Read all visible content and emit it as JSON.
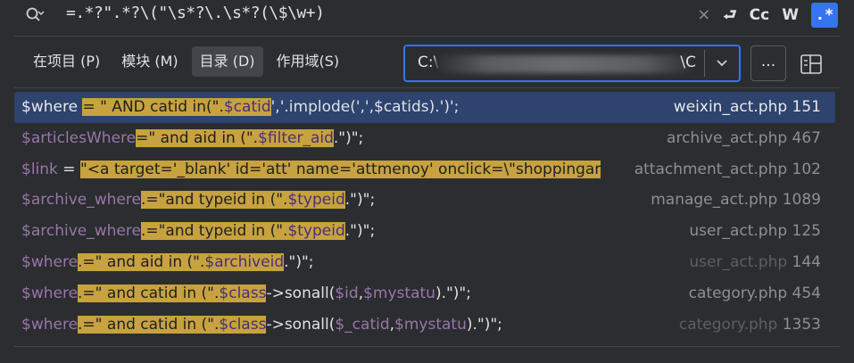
{
  "search": {
    "query": "=.*?\".*?\\(\"\\s*?\\.\\s*?(\\$\\w+)",
    "clear_label": "×",
    "newline_label": "⮐",
    "match_case_label": "Cc",
    "words_label": "W",
    "regex_label": ".*"
  },
  "scope": {
    "tabs": [
      {
        "label": "在项目 (P)"
      },
      {
        "label": "模块 (M)"
      },
      {
        "label": "目录 (D)"
      },
      {
        "label": "作用域(S)"
      }
    ],
    "active": 2
  },
  "directory": {
    "path_start": "C:\\",
    "path_end": "\\C",
    "browse_label": "..."
  },
  "results": [
    {
      "parts": [
        [
          "v",
          "$where"
        ],
        [
          "t",
          " "
        ],
        [
          "hl",
          "= \" AND catid in(\"."
        ],
        [
          "hv",
          "$catid"
        ],
        [
          "t",
          "','.implode(',',$catids).')';"
        ]
      ],
      "file": "weixin_act.php",
      "line": "151"
    },
    {
      "parts": [
        [
          "v",
          "$articlesWhere"
        ],
        [
          "hl",
          "=\" and aid in (\"."
        ],
        [
          "hv",
          "$filter_aid"
        ],
        [
          "t",
          ".\")\";"
        ]
      ],
      "file": "archive_act.php",
      "line": "467"
    },
    {
      "parts": [
        [
          "v",
          "$link"
        ],
        [
          "t",
          " = "
        ],
        [
          "hl",
          "\"<a target='_blank' id='att' name='attmenoy' onclick=\\\"shoppingar"
        ]
      ],
      "file": "attachment_act.php",
      "line": "102"
    },
    {
      "parts": [
        [
          "v",
          "$archive_where"
        ],
        [
          "hl",
          ".=\"and typeid in (\"."
        ],
        [
          "hv",
          "$typeid"
        ],
        [
          "t",
          ".\")\";"
        ]
      ],
      "file": "manage_act.php",
      "line": "1089"
    },
    {
      "parts": [
        [
          "v",
          "$archive_where"
        ],
        [
          "hl",
          ".=\"and typeid in (\"."
        ],
        [
          "hv",
          "$typeid"
        ],
        [
          "t",
          ".\")\";"
        ]
      ],
      "file": "user_act.php",
      "line": "125"
    },
    {
      "parts": [
        [
          "v",
          "$where"
        ],
        [
          "hl",
          ".=\" and aid in (\"."
        ],
        [
          "hv",
          "$archiveid"
        ],
        [
          "t",
          ".\")\";"
        ]
      ],
      "file": "user_act.php",
      "line": "144"
    },
    {
      "parts": [
        [
          "v",
          "$where"
        ],
        [
          "hl",
          ".=\" and catid in (\"."
        ],
        [
          "hv",
          "$class"
        ],
        [
          "t",
          "->sonall("
        ],
        [
          "v",
          "$id"
        ],
        [
          "t",
          ","
        ],
        [
          "v",
          "$mystatu"
        ],
        [
          "t",
          ").\")\";"
        ]
      ],
      "file": "category.php",
      "line": "454"
    },
    {
      "parts": [
        [
          "v",
          "$where"
        ],
        [
          "hl",
          ".=\" and catid in (\"."
        ],
        [
          "hv",
          "$class"
        ],
        [
          "t",
          "->sonall("
        ],
        [
          "v",
          "$_catid"
        ],
        [
          "t",
          ","
        ],
        [
          "v",
          "$mystatu"
        ],
        [
          "t",
          ").\")\";"
        ]
      ],
      "file": "category.php",
      "line": "1353"
    }
  ],
  "selected_index": 0,
  "dim_indices": [
    5,
    7
  ],
  "colors": {
    "accent": "#3574f0",
    "selection": "#2e436e",
    "highlight": "#c7a23e",
    "variable": "#9876aa"
  }
}
